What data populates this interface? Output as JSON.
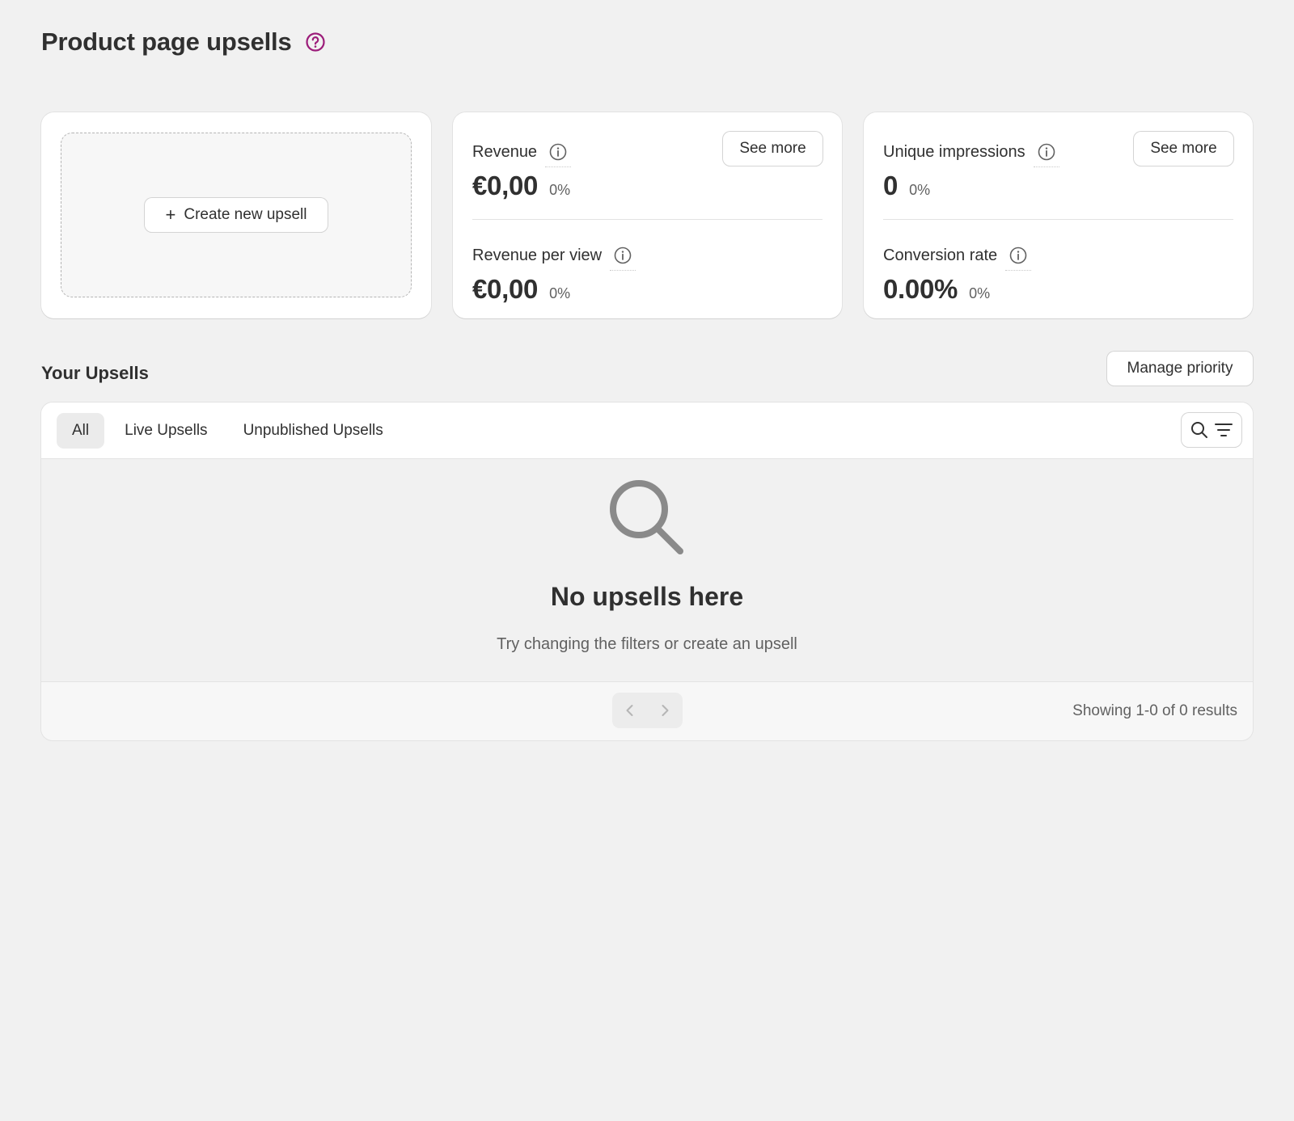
{
  "header": {
    "title": "Product page upsells"
  },
  "create_card": {
    "button_label": "Create new upsell"
  },
  "revenue_card": {
    "see_more_label": "See more",
    "revenue": {
      "label": "Revenue",
      "value": "€0,00",
      "change": "0%"
    },
    "revenue_per_view": {
      "label": "Revenue per view",
      "value": "€0,00",
      "change": "0%"
    }
  },
  "impressions_card": {
    "see_more_label": "See more",
    "unique_impressions": {
      "label": "Unique impressions",
      "value": "0",
      "change": "0%"
    },
    "conversion_rate": {
      "label": "Conversion rate",
      "value": "0.00%",
      "change": "0%"
    }
  },
  "upsells_section": {
    "title": "Your Upsells",
    "manage_priority_label": "Manage priority",
    "tabs": [
      {
        "label": "All",
        "active": true
      },
      {
        "label": "Live Upsells",
        "active": false
      },
      {
        "label": "Unpublished Upsells",
        "active": false
      }
    ],
    "empty_state": {
      "title": "No upsells here",
      "description": "Try changing the filters or create an upsell"
    },
    "footer": {
      "results_text": "Showing 1-0 of 0 results"
    }
  },
  "colors": {
    "accent": "#9c1d7a",
    "text": "#303030",
    "muted": "#616161",
    "background": "#f1f1f1"
  }
}
